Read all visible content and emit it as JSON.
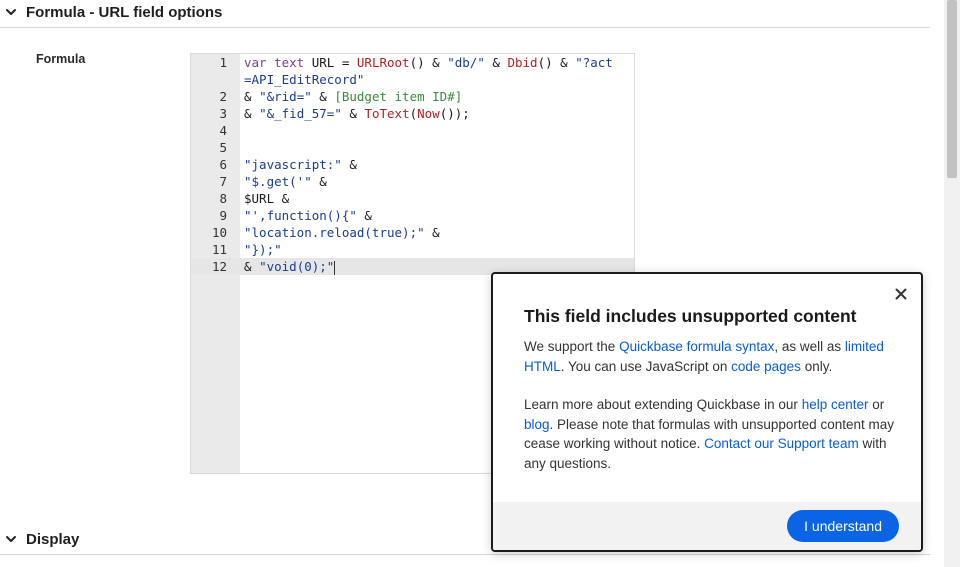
{
  "sections": {
    "formula_options": {
      "title": "Formula - URL field options"
    },
    "display": {
      "title": "Display"
    }
  },
  "formula_field": {
    "label": "Formula",
    "lines": [
      {
        "num": "1",
        "tokens": [
          {
            "t": "var ",
            "c": "kw"
          },
          {
            "t": "text ",
            "c": "kw"
          },
          {
            "t": "URL = ",
            "c": "plain"
          },
          {
            "t": "URLRoot",
            "c": "fn"
          },
          {
            "t": "() & ",
            "c": "plain"
          },
          {
            "t": "\"db/\"",
            "c": "str"
          },
          {
            "t": " & ",
            "c": "plain"
          },
          {
            "t": "Dbid",
            "c": "fn"
          },
          {
            "t": "() & ",
            "c": "plain"
          },
          {
            "t": "\"?act",
            "c": "str"
          }
        ]
      },
      {
        "num": "",
        "tokens": [
          {
            "t": "=API_EditRecord\"",
            "c": "str"
          }
        ]
      },
      {
        "num": "2",
        "tokens": [
          {
            "t": "& ",
            "c": "plain"
          },
          {
            "t": "\"&rid=\"",
            "c": "str"
          },
          {
            "t": " & ",
            "c": "plain"
          },
          {
            "t": "[Budget item ID#]",
            "c": "grn"
          }
        ]
      },
      {
        "num": "3",
        "tokens": [
          {
            "t": "& ",
            "c": "plain"
          },
          {
            "t": "\"&_fid_57=\"",
            "c": "str"
          },
          {
            "t": " & ",
            "c": "plain"
          },
          {
            "t": "ToText",
            "c": "fn"
          },
          {
            "t": "(",
            "c": "plain"
          },
          {
            "t": "Now",
            "c": "fn"
          },
          {
            "t": "());",
            "c": "plain"
          }
        ]
      },
      {
        "num": "4",
        "tokens": []
      },
      {
        "num": "5",
        "tokens": []
      },
      {
        "num": "6",
        "tokens": [
          {
            "t": "\"javascript:\"",
            "c": "str"
          },
          {
            "t": " &",
            "c": "plain"
          }
        ]
      },
      {
        "num": "7",
        "tokens": [
          {
            "t": "\"$.get('\"",
            "c": "str"
          },
          {
            "t": " &",
            "c": "plain"
          }
        ]
      },
      {
        "num": "8",
        "tokens": [
          {
            "t": "$URL &",
            "c": "plain"
          }
        ]
      },
      {
        "num": "9",
        "tokens": [
          {
            "t": "\"',function(){\"",
            "c": "str"
          },
          {
            "t": " &",
            "c": "plain"
          }
        ]
      },
      {
        "num": "10",
        "tokens": [
          {
            "t": "\"location.reload(true);\"",
            "c": "str"
          },
          {
            "t": " &",
            "c": "plain"
          }
        ]
      },
      {
        "num": "11",
        "tokens": [
          {
            "t": "\"});\"",
            "c": "str"
          }
        ]
      },
      {
        "num": "12",
        "tokens": [
          {
            "t": "& ",
            "c": "plain"
          },
          {
            "t": "\"void(0);\"",
            "c": "str"
          }
        ],
        "active": true
      }
    ]
  },
  "modal": {
    "title": "This field includes unsupported content",
    "p1_a": "We support the ",
    "p1_link1": "Quickbase formula syntax",
    "p1_b": ", as well as ",
    "p1_link2": "limited HTML",
    "p1_c": ". You can use JavaScript on ",
    "p1_link3": "code pages",
    "p1_d": " only.",
    "p2_a": "Learn more about extending Quickbase in our ",
    "p2_link1": "help center",
    "p2_b": " or ",
    "p2_link2": "blog",
    "p2_c": ". Please note that formulas with unsupported content may cease working without notice. ",
    "p2_link3": "Contact our Support team",
    "p2_d": " with any questions.",
    "button": "I understand"
  },
  "icons": {
    "section_toggle": "chevron-down-icon",
    "close": "close-icon"
  },
  "colors": {
    "link": "#0a5dd6",
    "primary_button": "#0b63e5"
  }
}
